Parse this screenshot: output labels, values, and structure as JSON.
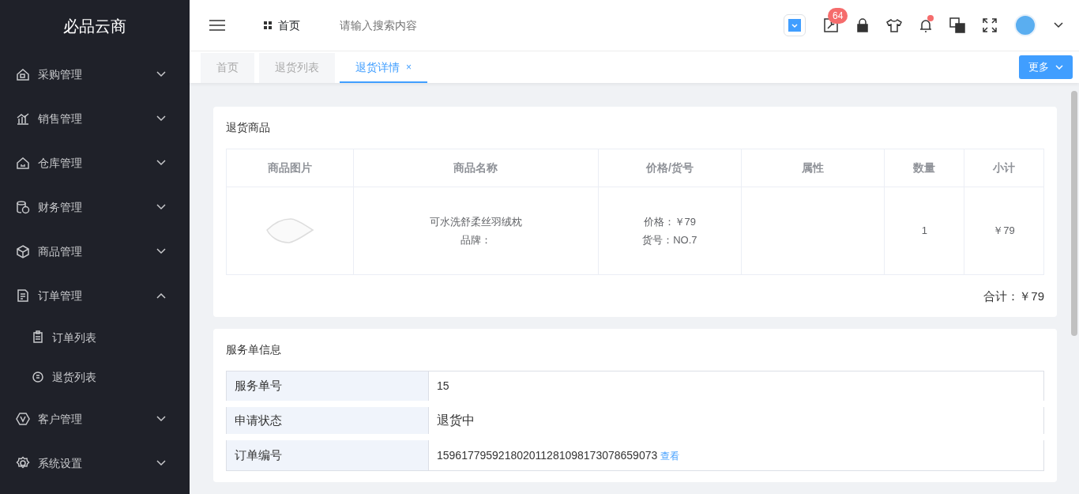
{
  "brand": "必品云商",
  "sidebar": {
    "items": [
      {
        "label": "采购管理",
        "expanded": false
      },
      {
        "label": "销售管理",
        "expanded": false
      },
      {
        "label": "仓库管理",
        "expanded": false
      },
      {
        "label": "财务管理",
        "expanded": false
      },
      {
        "label": "商品管理",
        "expanded": false
      },
      {
        "label": "订单管理",
        "expanded": true,
        "children": [
          {
            "label": "订单列表",
            "selected": false
          },
          {
            "label": "退货列表",
            "selected": false
          }
        ]
      },
      {
        "label": "客户管理",
        "expanded": false
      },
      {
        "label": "系统设置",
        "expanded": false
      }
    ]
  },
  "header": {
    "breadcrumb": "首页",
    "search": {
      "placeholder": "请输入搜索内容"
    },
    "notification_badge": "64",
    "bell_dot": true
  },
  "tabs": [
    {
      "label": "首页",
      "selected": false
    },
    {
      "label": "退货列表",
      "selected": false
    },
    {
      "label": "退货详情",
      "selected": true,
      "close": "×"
    }
  ],
  "more_button": "更多",
  "goods": {
    "title": "退货商品",
    "columns": [
      "商品图片",
      "商品名称",
      "价格/货号",
      "属性",
      "数量",
      "小计"
    ],
    "rows": [
      {
        "name": "可水洗舒柔丝羽绒枕",
        "brand": "品牌：",
        "price": "价格：￥79",
        "sku": "货号：NO.7",
        "quantity": "1",
        "subtotal": "￥79"
      }
    ],
    "total": "合计：￥79"
  },
  "service": {
    "title": "服务单信息",
    "rows": [
      {
        "label": "服务单号",
        "value": "15"
      },
      {
        "label": "申请状态",
        "value": "退货中"
      },
      {
        "label": "订单编号",
        "value": "159617795921802011281098173078659073",
        "link": "查看"
      }
    ]
  }
}
